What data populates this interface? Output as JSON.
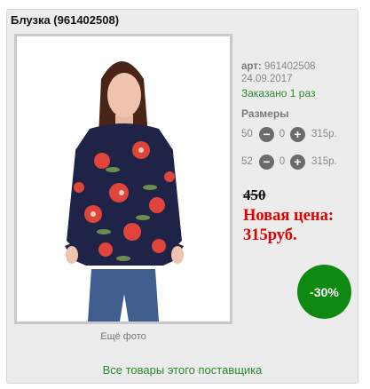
{
  "product": {
    "title": "Блузка (961402508)",
    "article_label": "арт:",
    "article": "961402508",
    "date": "24.09.2017",
    "ordered": "Заказано 1 раз",
    "sizes_title": "Размеры",
    "sizes": [
      {
        "size": "50",
        "qty": "0",
        "price": "315р."
      },
      {
        "size": "52",
        "qty": "0",
        "price": "315р."
      }
    ],
    "old_price": "450",
    "new_price_label": "Новая цена:",
    "new_price": "315руб.",
    "discount": "-30%",
    "more_photos": "Ещё фото",
    "all_supplier_products": "Все товары этого поставщика"
  },
  "colors": {
    "background_card": "#ececec",
    "price_red": "#e00000",
    "link_green": "#2a8a2a",
    "badge_green": "#0e8a12"
  },
  "icons": [
    "minus-circle-icon",
    "plus-circle-icon"
  ]
}
